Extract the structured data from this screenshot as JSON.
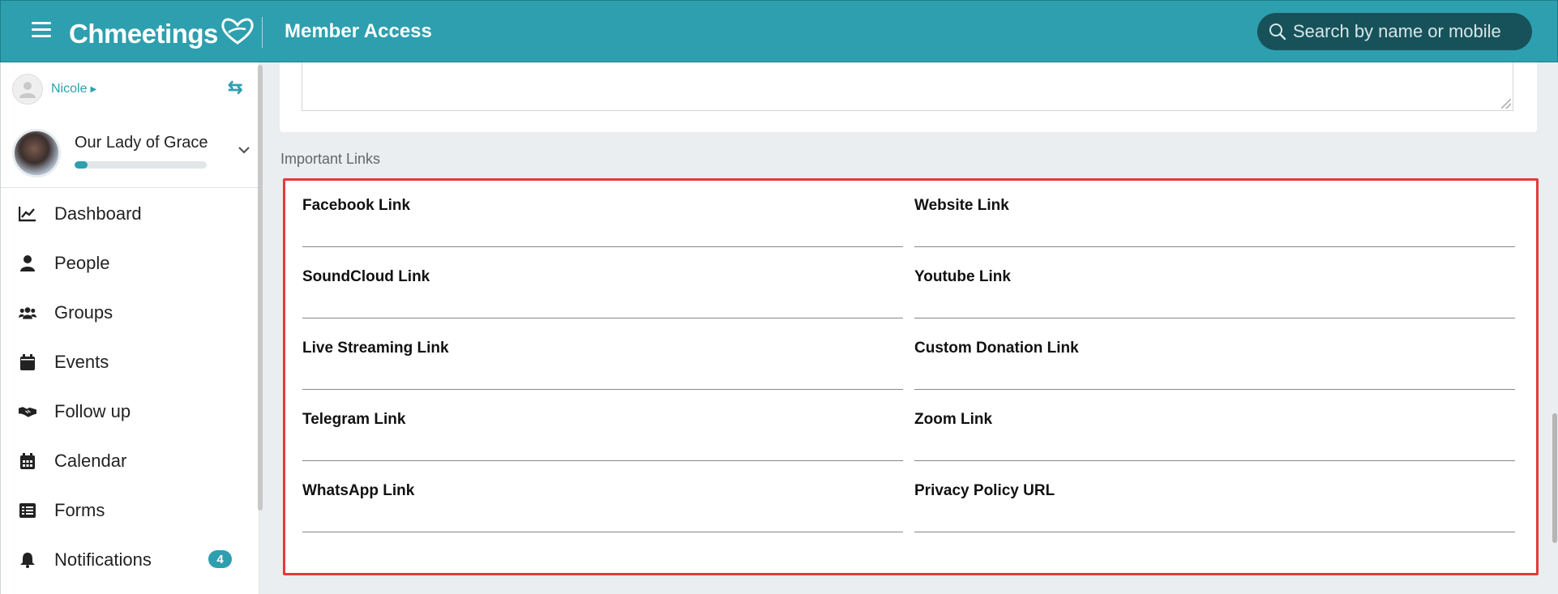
{
  "app": {
    "logo_text": "Chmeetings",
    "page_title": "Member Access",
    "search_placeholder": "Search by name or mobile"
  },
  "sidebar": {
    "user_name": "Nicole",
    "church_name": "Our Lady of Grace",
    "church_progress": 0.1,
    "items": [
      {
        "label": "Dashboard",
        "icon": "chart-line-icon"
      },
      {
        "label": "People",
        "icon": "person-icon"
      },
      {
        "label": "Groups",
        "icon": "users-icon"
      },
      {
        "label": "Events",
        "icon": "calendar-solid-icon"
      },
      {
        "label": "Follow up",
        "icon": "handshake-icon"
      },
      {
        "label": "Calendar",
        "icon": "calendar-grid-icon"
      },
      {
        "label": "Forms",
        "icon": "list-icon"
      },
      {
        "label": "Notifications",
        "icon": "bell-icon",
        "badge": "4"
      }
    ]
  },
  "main": {
    "section_title": "Important Links",
    "links": [
      {
        "label": "Facebook Link",
        "value": ""
      },
      {
        "label": "Website Link",
        "value": ""
      },
      {
        "label": "SoundCloud Link",
        "value": ""
      },
      {
        "label": "Youtube Link",
        "value": ""
      },
      {
        "label": "Live Streaming Link",
        "value": ""
      },
      {
        "label": "Custom Donation Link",
        "value": ""
      },
      {
        "label": "Telegram Link",
        "value": ""
      },
      {
        "label": "Zoom Link",
        "value": ""
      },
      {
        "label": "WhatsApp Link",
        "value": ""
      },
      {
        "label": "Privacy Policy URL",
        "value": ""
      }
    ]
  },
  "colors": {
    "brand": "#2e9fae",
    "search_bg": "#17525a",
    "highlight_border": "#e43a3a"
  }
}
